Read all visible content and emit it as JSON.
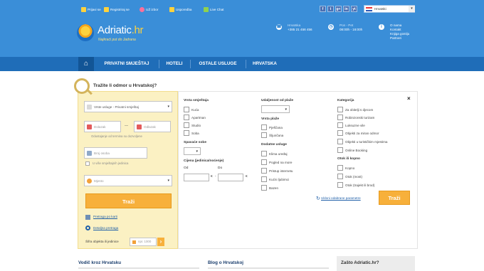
{
  "topbar": {
    "links": [
      {
        "label": "Prijavi se",
        "icon": "user-icon"
      },
      {
        "label": "Registriraj se",
        "icon": "register-icon"
      },
      {
        "label": "UŽ izbor",
        "icon": "heart-icon"
      },
      {
        "label": "Usporedba",
        "icon": "chart-icon"
      },
      {
        "label": "Live Chat",
        "icon": "chat-icon"
      }
    ],
    "social": [
      "f",
      "t",
      "g+",
      "in",
      "yt"
    ],
    "language": "Hrvatski"
  },
  "header": {
    "brand_main": "Adriatic",
    "brand_suffix": ".hr",
    "tagline": "Najkraći put do Jadrana",
    "phone_label": "Hrvatska",
    "phone": "+385 21 456 456",
    "hours_label": "Pon - Pet",
    "hours": "08:00h - 16:00h",
    "info_links": [
      "O nama",
      "Kontakt",
      "Knjiga gostiju",
      "Partneri"
    ]
  },
  "nav": {
    "items": [
      "PRIVATNI SMJEŠTAJ",
      "HOTELI",
      "OSTALE USLUGE",
      "HRVATSKA"
    ]
  },
  "search": {
    "title": "Tražite li odmor u Hrvatskoj?",
    "service_type": "Vrste usluge - Privatni smještaj",
    "checkin_placeholder": "Dolazak",
    "checkout_placeholder": "Odlazak",
    "date_separator": "—",
    "date_hint": "Odustajanje od termina su dozvoljene",
    "persons_placeholder": "Broj osoba",
    "persons_hint": "U više smještajnih jedinica",
    "location_placeholder": "Mjesto",
    "search_label": "Traži",
    "map_link": "Pretraga po karti",
    "detail_link": "Detaljna pretraga",
    "code_label": "Šifra objekta ili jedinice",
    "code_placeholder": "npr. 1000",
    "code_go": "›"
  },
  "filters": {
    "accommodation_type": {
      "title": "Vrsta smještaja",
      "options": [
        "Kuća",
        "Apartman",
        "Studio",
        "Soba"
      ]
    },
    "bedrooms_title": "Spavaće sobe",
    "price": {
      "title": "Cijena (jedinica/noćenje)",
      "from": "Od",
      "to": "Do",
      "currency": "€",
      "dash": "-"
    },
    "beach_distance_title": "Udaljenost od plaže",
    "beach_type": {
      "title": "Vrsta plaže",
      "options": [
        "Pješčana",
        "Šljunčana"
      ]
    },
    "extra_services": {
      "title": "Dodatne usluge",
      "options": [
        "Klima uređaj",
        "Pogled na more",
        "Pristup internetu",
        "Kućni ljubimci",
        "Bazen"
      ]
    },
    "category": {
      "title": "Kategorija",
      "options": [
        "Za obitelji s djecom",
        "Robinzonski turizam",
        "Luksuzne vile",
        "Objekti za miran odmor",
        "Objekti u turističkim mjestima",
        "Online Booking"
      ]
    },
    "island_location": {
      "title": "Otok ili kopno",
      "options": [
        "Kopno",
        "Otok (most)",
        "Otok (trajekt ili brod)"
      ]
    },
    "reset_label": "Ukloni odabrane parametre",
    "search_label": "Traži",
    "close_label": "×"
  },
  "bottom": {
    "guide_title": "Vodič kroz Hrvatsku",
    "blog_title": "Blog o Hrvatskoj",
    "why_title": "Zašto Adriatic.hr?"
  },
  "colors": {
    "header_blue": "#3a8ed8",
    "nav_blue": "#1f6db8",
    "accent_orange": "#f7b03b",
    "panel_yellow": "#fbf1c3",
    "link_blue": "#1f5fa8"
  }
}
